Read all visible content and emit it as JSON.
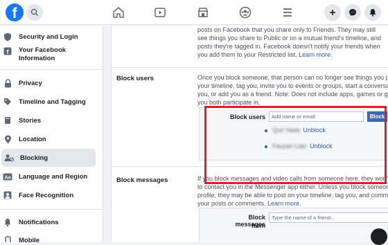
{
  "colors": {
    "brand": "#1877f2",
    "link": "#385898",
    "highlight": "#e02020",
    "button": "#4267b2"
  },
  "topbar": {
    "logo_letter": "f",
    "icons": [
      "search-icon",
      "home-icon",
      "watch-icon",
      "marketplace-icon",
      "groups-icon",
      "menu-icon",
      "plus-icon",
      "messenger-icon",
      "notifications-icon"
    ]
  },
  "sidebar": {
    "items": [
      {
        "label": "Security and Login",
        "icon": "shield-icon"
      },
      {
        "label": "Your Facebook Information",
        "icon": "facebook-info-icon"
      },
      {
        "label": "Privacy",
        "icon": "lock-icon"
      },
      {
        "label": "Timeline and Tagging",
        "icon": "tag-icon"
      },
      {
        "label": "Stories",
        "icon": "book-icon"
      },
      {
        "label": "Location",
        "icon": "location-pin-icon"
      },
      {
        "label": "Blocking",
        "icon": "blocking-icon",
        "active": true
      },
      {
        "label": "Language and Region",
        "icon": "language-icon"
      },
      {
        "label": "Face Recognition",
        "icon": "face-icon"
      },
      {
        "label": "Notifications",
        "icon": "bell-icon"
      },
      {
        "label": "Mobile",
        "icon": "mobile-icon"
      }
    ]
  },
  "restricted": {
    "lines": [
      "posts on Facebook that you share only to Friends. They may still",
      "see things you share to Public or on a mutual friend's timeline, and",
      "posts they're tagged in. Facebook doesn't notify your friends when",
      "you add them to your Restricted list."
    ],
    "learn_more": "Learn more."
  },
  "block_users": {
    "title": "Block users",
    "lines": [
      "Once you block someone, that person can no longer see things you pos",
      "your timeline, tag you, invite you to events or groups, start a conversatio",
      "you, or add you as a friend. Note: Does not include apps, games or grou",
      "you both participate in."
    ],
    "field_label": "Block users",
    "placeholder": "Add name or email",
    "button": "Block",
    "blocked": [
      {
        "name": "Quri Vada",
        "action": "Unblock"
      },
      {
        "name": "Fauzan Lian",
        "action": "Unblock"
      }
    ]
  },
  "block_messages": {
    "title": "Block messages",
    "lines": [
      "If you block messages and video calls from someone here, they won't b",
      "to contact you in the Messenger app either. Unless you block someone'",
      "profile, they may be able to post on your timeline, tag you, and comment",
      "your posts or comments."
    ],
    "learn_more": "Learn more.",
    "field_label_1": "Block messages",
    "field_label_2": "from",
    "placeholder": "Type the name of a friend..."
  }
}
